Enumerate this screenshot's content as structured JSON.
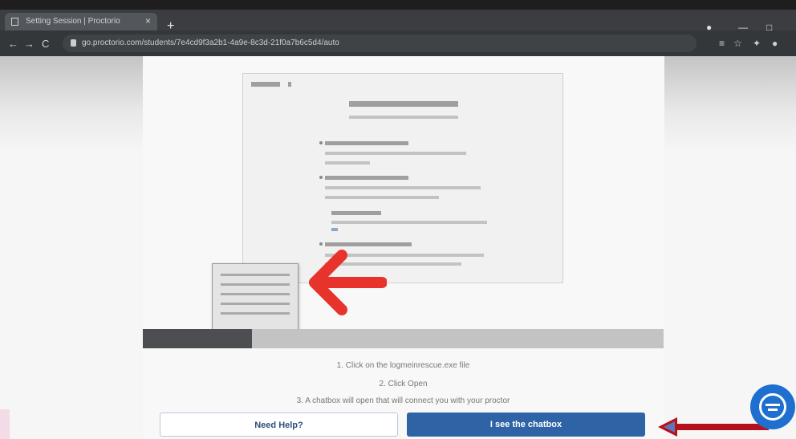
{
  "browser": {
    "tab_title": "Setting Session | Proctorio",
    "tab_close": "×",
    "new_tab": "+",
    "url": "go.proctorio.com/students/7e4cd9f3a2b1-4a9e-8c3d-21f0a7b6c5d4/auto",
    "nav": {
      "back": "←",
      "forward": "→",
      "reload": "C"
    },
    "window": {
      "minimize": "—",
      "maximize": "□"
    }
  },
  "page": {
    "progress": 0.21,
    "instructions": [
      "1. Click on the logmeinrescue.exe file",
      "2. Click Open",
      "3. A chatbox will open that will connect you with your proctor"
    ],
    "buttons": {
      "need_help": "Need Help?",
      "i_see_chatbox": "I see the chatbox"
    }
  },
  "colors": {
    "primary_button": "#2e63a6",
    "red_arrow": "#e8332c",
    "dark_red_arrow": "#b5121b",
    "chat_fab": "#1e6fd0",
    "progress_fill": "#4d4e52"
  },
  "icons": {
    "chat_widget": "chat-bubble-icon",
    "pointer_arrow": "red-arrow-icon"
  }
}
